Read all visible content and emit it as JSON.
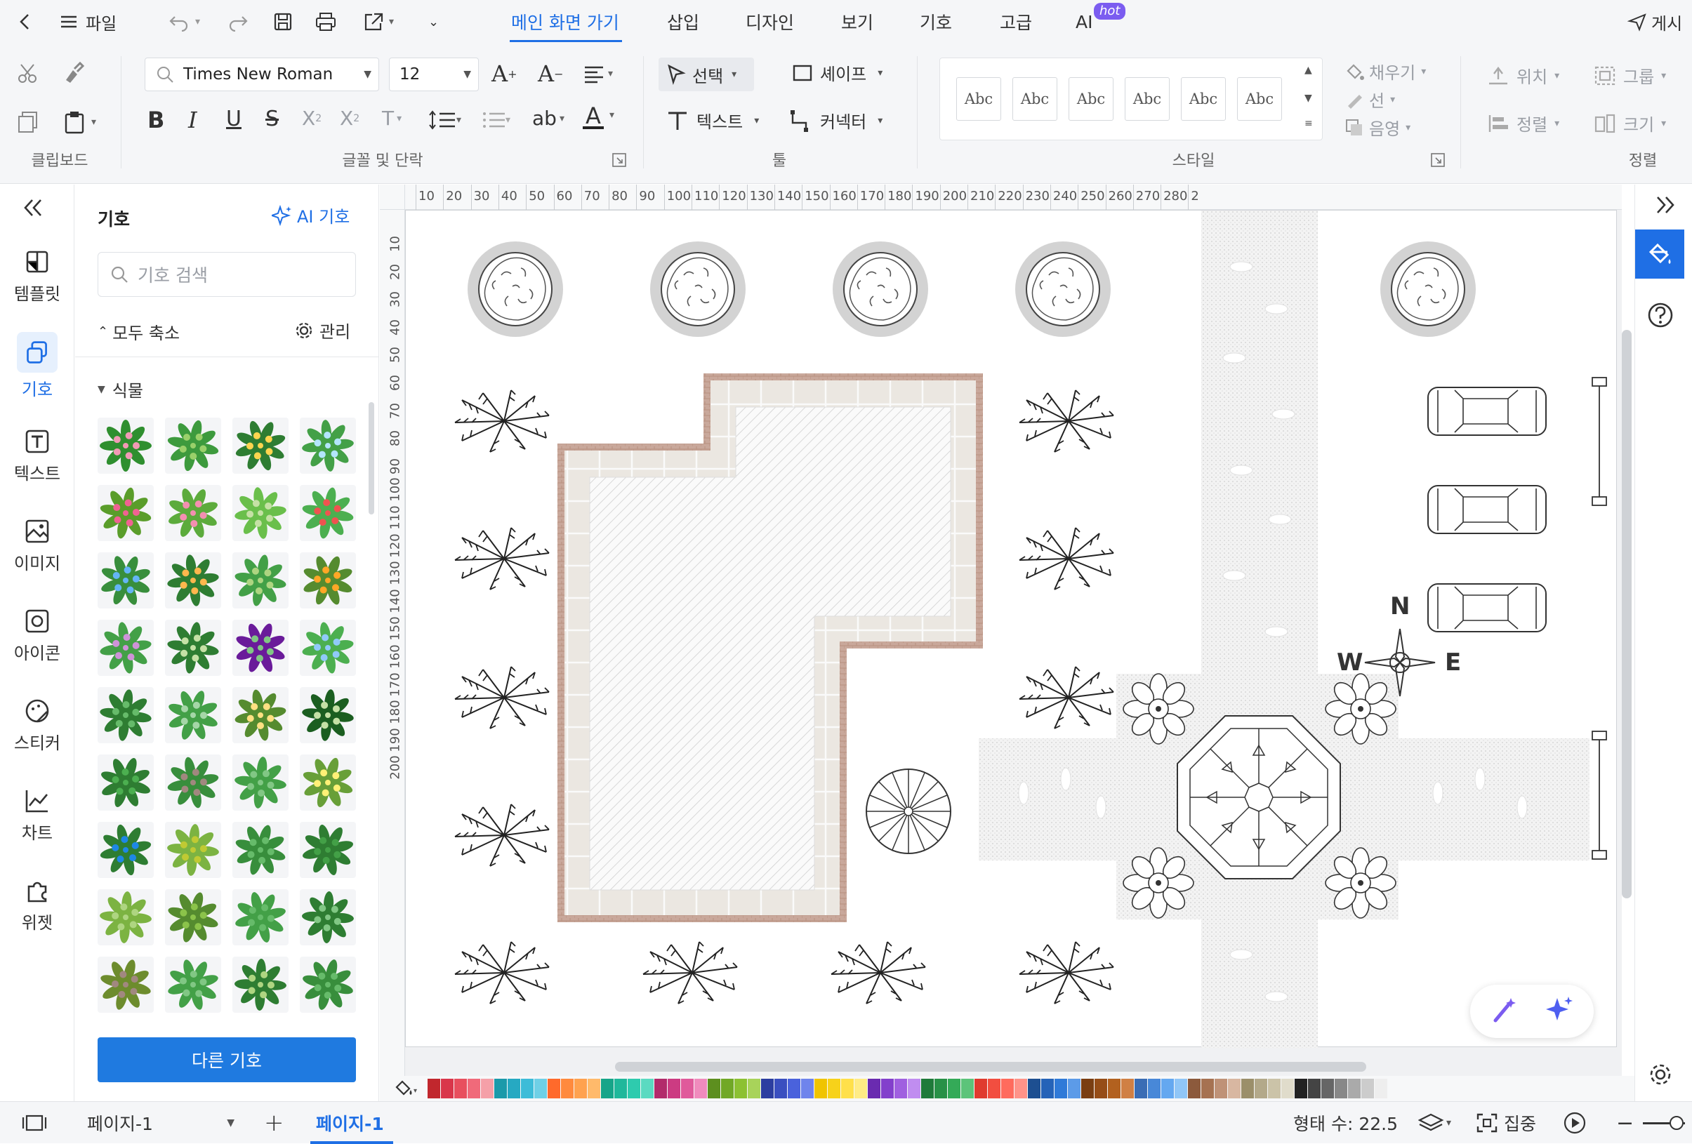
{
  "topbar": {
    "file_label": "파일",
    "publish_label": "게시",
    "tabs": [
      {
        "label": "메인 화면 가기"
      },
      {
        "label": "삽입"
      },
      {
        "label": "디자인"
      },
      {
        "label": "보기"
      },
      {
        "label": "기호"
      },
      {
        "label": "고급"
      },
      {
        "label": "AI"
      }
    ],
    "ai_badge": "hot"
  },
  "ribbon": {
    "font_name": "Times New Roman",
    "font_size": "12",
    "select_label": "선택",
    "shape_label": "셰이프",
    "text_label": "텍스트",
    "connector_label": "커넥터",
    "style_sample": "Abc",
    "fill_label": "채우기",
    "line_label": "선",
    "shadow_label": "음영",
    "position_label": "위치",
    "group_label": "그룹",
    "align_label": "정렬",
    "size_label": "크기",
    "groups": {
      "clipboard": "클립보드",
      "font": "글꼴 및 단락",
      "tools": "툴",
      "style": "스타일",
      "arrange": "정렬"
    }
  },
  "leftnav": {
    "items": [
      {
        "label": "템플릿",
        "icon": "template-icon"
      },
      {
        "label": "기호",
        "icon": "symbol-icon"
      },
      {
        "label": "텍스트",
        "icon": "text-icon"
      },
      {
        "label": "이미지",
        "icon": "image-icon"
      },
      {
        "label": "아이콘",
        "icon": "icon-icon"
      },
      {
        "label": "스티커",
        "icon": "sticker-icon"
      },
      {
        "label": "차트",
        "icon": "chart-icon"
      },
      {
        "label": "위젯",
        "icon": "widget-icon"
      }
    ]
  },
  "panel": {
    "title": "기호",
    "ai_link": "AI 기호",
    "search_placeholder": "기호 검색",
    "collapse_all": "모두 축소",
    "manage": "관리",
    "category": "식물",
    "more_button": "다른 기호"
  },
  "ruler": {
    "top_ticks": [
      "10",
      "20",
      "30",
      "40",
      "50",
      "60",
      "70",
      "80",
      "90",
      "100",
      "110",
      "120",
      "130",
      "140",
      "150",
      "160",
      "170",
      "180",
      "190",
      "200",
      "210",
      "220",
      "230",
      "240",
      "250",
      "260",
      "270",
      "280",
      "2"
    ],
    "left_ticks": [
      "10",
      "20",
      "30",
      "40",
      "50",
      "60",
      "70",
      "80",
      "90",
      "100",
      "110",
      "120",
      "130",
      "140",
      "150",
      "160",
      "170",
      "180",
      "190",
      "200"
    ]
  },
  "canvas": {
    "compass": {
      "n": "N",
      "w": "W",
      "e": "E"
    }
  },
  "status": {
    "page_select": "페이지-1",
    "active_page": "페이지-1",
    "shape_count_label": "형태 수: 22.5",
    "focus_label": "집중"
  },
  "palette_colors": [
    "#c1272d",
    "#d9364a",
    "#e84f5e",
    "#f06a7a",
    "#f5a0a8",
    "#1b9aaa",
    "#26a9c2",
    "#3dbcd8",
    "#6fd0e6",
    "#ff6a2b",
    "#ff8a3d",
    "#ffa24f",
    "#ffba6b",
    "#17a589",
    "#20b89b",
    "#2ecbae",
    "#5bdac1",
    "#b22b6b",
    "#cc3b82",
    "#e05a9b",
    "#f08bbd",
    "#5d8f1f",
    "#71a826",
    "#8cc132",
    "#a8d35a",
    "#2c3ea0",
    "#3a4fc0",
    "#4a62dc",
    "#6f84ec",
    "#f0c400",
    "#f7d21a",
    "#ffe04a",
    "#ffec85",
    "#6a2bb0",
    "#8340cc",
    "#a060e0",
    "#c08df0",
    "#1f7a3a",
    "#289147",
    "#34aa58",
    "#5cc47a",
    "#e03b2f",
    "#f24e40",
    "#ff6b5d",
    "#ff9389",
    "#1d4f91",
    "#2563b8",
    "#2f7ad8",
    "#5c9be8",
    "#7a3e12",
    "#964d17",
    "#b2611f",
    "#d08044",
    "#3a6db5",
    "#4888d8",
    "#64a8f0",
    "#90c6f7",
    "#8c5a3c",
    "#a67251",
    "#bf9277",
    "#d8b7a1",
    "#9b8f6a",
    "#b3a98a",
    "#cbc3a8",
    "#e0dccb",
    "#222222",
    "#444444",
    "#666666",
    "#888888",
    "#aaaaaa",
    "#cccccc",
    "#eeeeee"
  ]
}
